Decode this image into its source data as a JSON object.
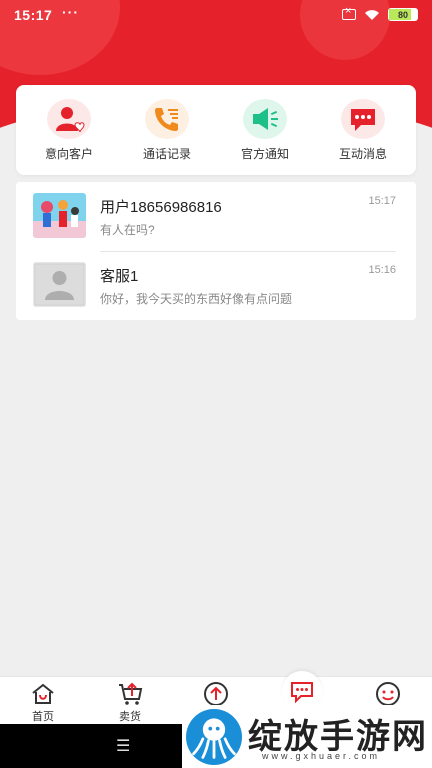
{
  "status_bar": {
    "time": "15:17",
    "dots": "···",
    "battery": "80"
  },
  "quick_actions": [
    {
      "label": "意向客户",
      "icon": "customer-heart-icon",
      "color": "#e5212b"
    },
    {
      "label": "通话记录",
      "icon": "phone-log-icon",
      "color": "#f08a1c"
    },
    {
      "label": "官方通知",
      "icon": "megaphone-icon",
      "color": "#1ec08a"
    },
    {
      "label": "互动消息",
      "icon": "chat-bubble-icon",
      "color": "#e5212b"
    }
  ],
  "messages": [
    {
      "name": "用户18656986816",
      "preview": "有人在吗?",
      "time": "15:17"
    },
    {
      "name": "客服1",
      "preview": "你好，我今天买的东西好像有点问题",
      "time": "15:16"
    }
  ],
  "tabbar": {
    "home": "首页",
    "sell": "卖货"
  },
  "navbar": {
    "menu": "☰"
  },
  "watermark": {
    "title": "绽放手游网",
    "subtitle": "www.gxhuaer.com"
  },
  "colors": {
    "brand": "#e5212b",
    "background": "#efefef"
  }
}
